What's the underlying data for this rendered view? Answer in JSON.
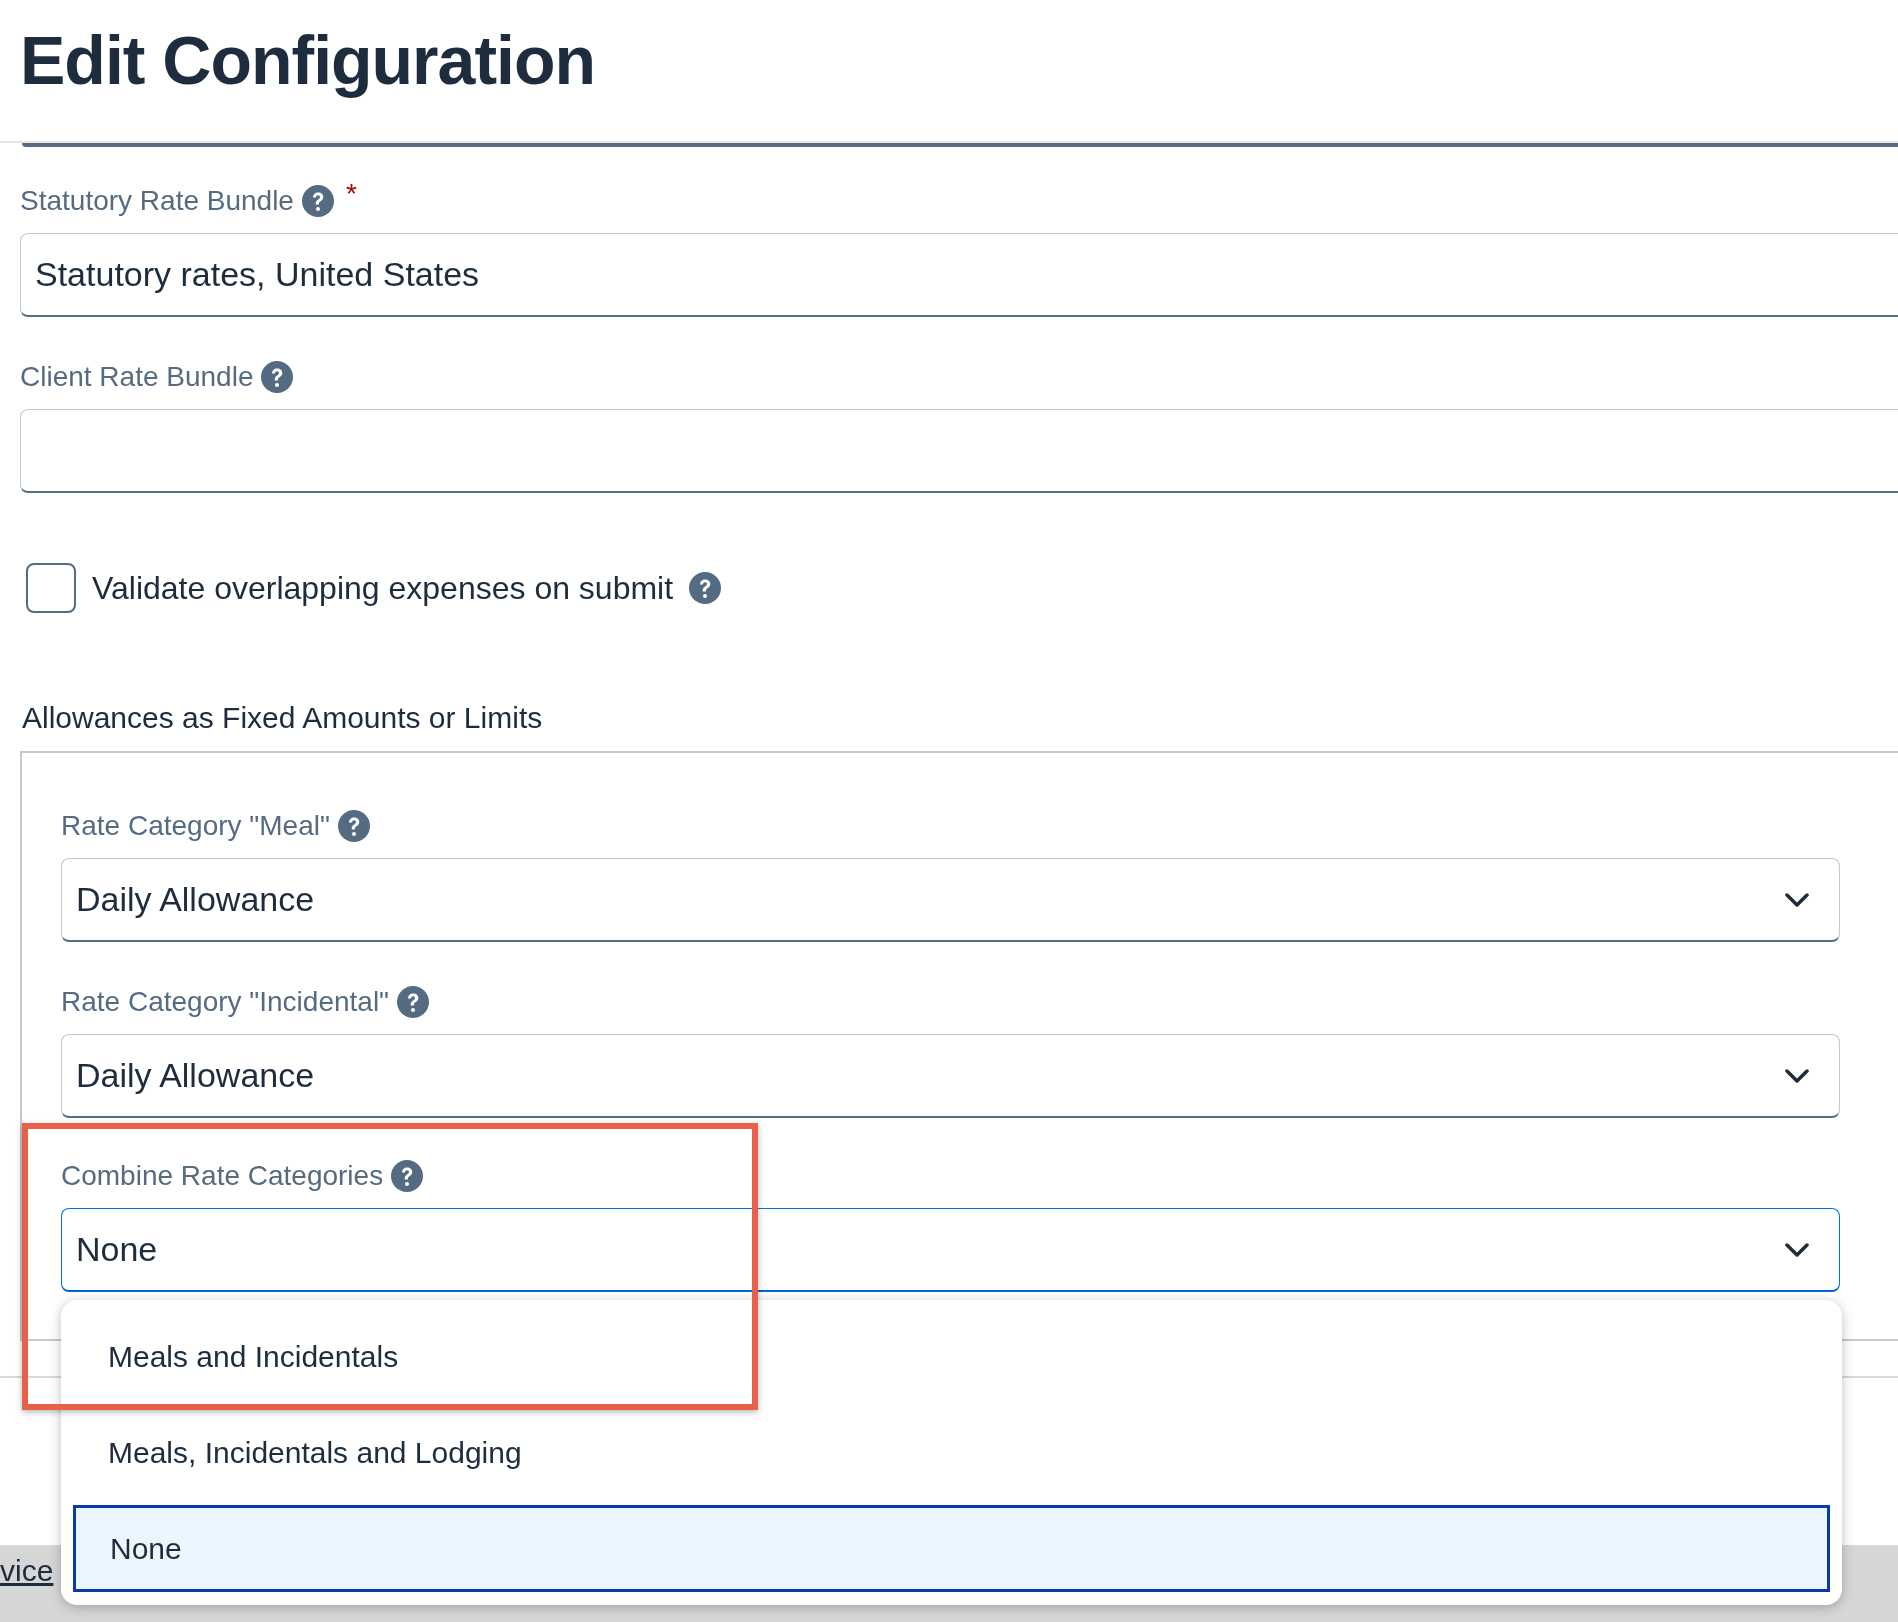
{
  "title": "Edit Configuration",
  "fields": [
    {
      "label": "Statutory Rate Bundle",
      "required_mark": "*",
      "value": "Statutory rates, United States"
    },
    {
      "label": "Client Rate Bundle"
    }
  ],
  "checkbox": {
    "label": "Validate overlapping expenses on submit",
    "checked": false
  },
  "section": {
    "title": "Allowances as Fixed Amounts or Limits",
    "selects": [
      {
        "label": "Rate Category \"Meal\"",
        "value": "Daily Allowance",
        "focused": false
      },
      {
        "label": "Rate Category \"Incidental\"",
        "value": "Daily Allowance",
        "focused": false
      },
      {
        "label": "Combine Rate Categories",
        "value": "None",
        "focused": true
      }
    ]
  },
  "dropdown": {
    "options": [
      {
        "label": "Meals and Incidentals",
        "selected": false
      },
      {
        "label": "Meals, Incidentals and Lodging",
        "selected": false
      },
      {
        "label": "None",
        "selected": true
      }
    ]
  },
  "highlight_frame": true,
  "footer_link": "vice"
}
